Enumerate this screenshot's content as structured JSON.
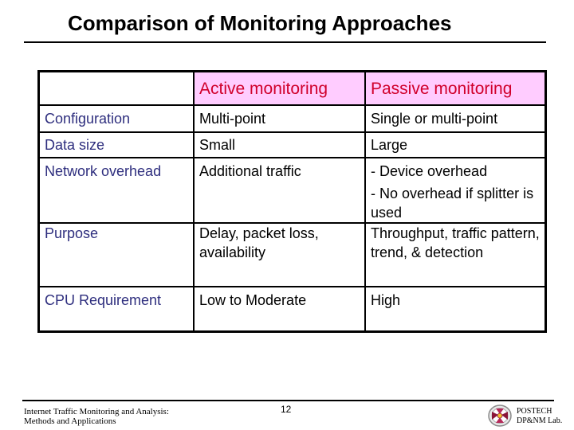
{
  "slide": {
    "title": "Comparison of Monitoring Approaches"
  },
  "table": {
    "headers": [
      "",
      "Active monitoring",
      "Passive monitoring"
    ],
    "rows": [
      {
        "label": "Configuration",
        "active": [
          "Multi-point"
        ],
        "passive": [
          "Single or multi-point"
        ]
      },
      {
        "label": "Data size",
        "active": [
          "Small"
        ],
        "passive": [
          "Large"
        ]
      },
      {
        "label": "Network overhead",
        "active": [
          "Additional traffic"
        ],
        "passive": [
          "- Device overhead",
          "- No overhead if splitter is used"
        ]
      },
      {
        "label": "Purpose",
        "active": [
          "Delay, packet loss, availability"
        ],
        "passive": [
          "Throughput, traffic pattern, trend, & detection"
        ]
      },
      {
        "label": "CPU Requirement",
        "active": [
          "Low to Moderate"
        ],
        "passive": [
          "High"
        ]
      }
    ]
  },
  "footer": {
    "left_line1": "Internet Traffic Monitoring and Analysis:",
    "left_line2": "Methods and Applications",
    "page_number": "12",
    "right_line1": "POSTECH",
    "right_line2": "DP&NM Lab.",
    "logo_icon": "postech-emblem-icon"
  },
  "colors": {
    "header_fill": "#ffccff",
    "header_text": "#d0002b",
    "row_label_text": "#2e2e7e"
  }
}
